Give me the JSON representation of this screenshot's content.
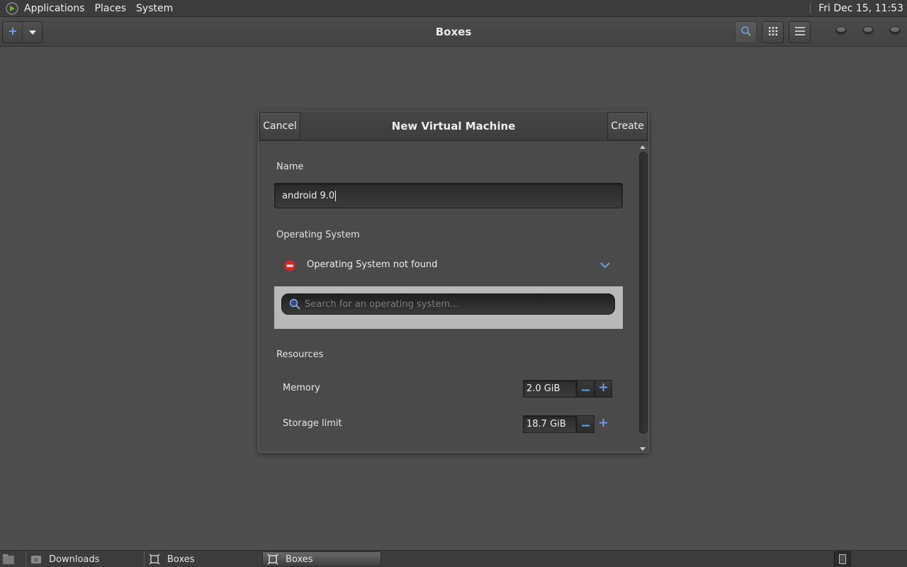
{
  "top_panel": {
    "menus": [
      "Applications",
      "Places",
      "System"
    ],
    "clock": "Fri Dec 15, 11:53"
  },
  "header": {
    "title": "Boxes",
    "new_icon": "plus-icon",
    "dropdown_icon": "triangle-down-icon",
    "search_icon": "search-icon",
    "grid_icon": "grid-icon",
    "menu_icon": "hamburger-icon"
  },
  "dialog": {
    "title": "New Virtual Machine",
    "cancel_label": "Cancel",
    "create_label": "Create",
    "name_label": "Name",
    "name_value": "android 9.0",
    "os_label": "Operating System",
    "os_status": "Operating System not found",
    "os_search_placeholder": "Search for an operating system…",
    "resources_label": "Resources",
    "memory": {
      "label": "Memory",
      "value": "2.0 GiB"
    },
    "storage": {
      "label": "Storage limit",
      "value": "18.7 GiB"
    }
  },
  "taskbar": {
    "tasks": [
      {
        "label": "Downloads",
        "icon": "folder-icon",
        "active": false
      },
      {
        "label": "Boxes",
        "icon": "boxes-icon",
        "active": false
      },
      {
        "label": "Boxes",
        "icon": "boxes-icon",
        "active": true
      }
    ]
  },
  "colors": {
    "background": "#4e4e4e",
    "panel": "#3c3c3c",
    "accent_blue": "#6aa0e8",
    "error_red": "#e02424",
    "search_panel": "#b8b8b8"
  }
}
